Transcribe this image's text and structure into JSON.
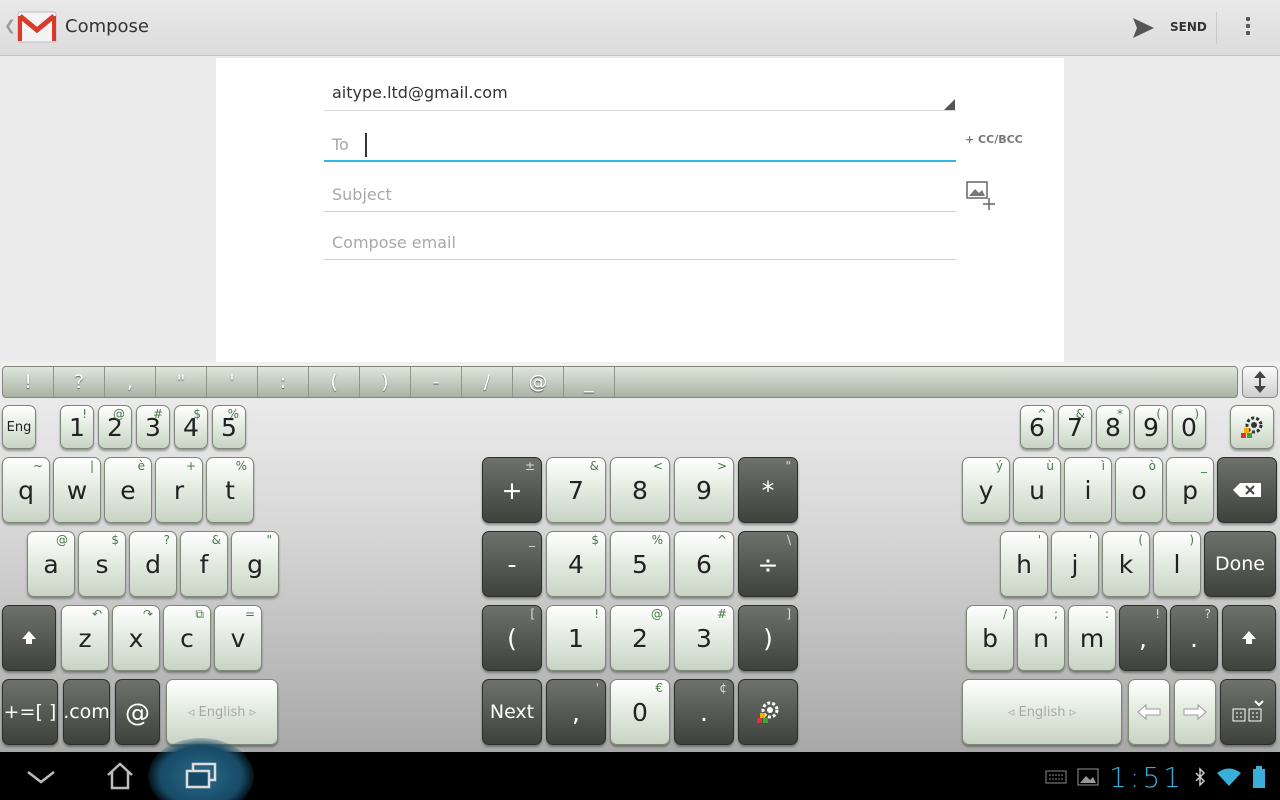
{
  "actionbar": {
    "title": "Compose",
    "send_label": "SEND"
  },
  "compose": {
    "from": "aitype.ltd@gmail.com",
    "to_placeholder": "To",
    "cc_bcc_label": "+ CC/BCC",
    "subject_placeholder": "Subject",
    "body_placeholder": "Compose email"
  },
  "keyboard": {
    "symbols": [
      "!",
      "?",
      ",",
      "\"",
      "'",
      ":",
      "(",
      ")",
      "-",
      "/",
      "@",
      "_"
    ],
    "lang_label": "Eng",
    "num_left": [
      {
        "l": "1",
        "a": "!"
      },
      {
        "l": "2",
        "a": "@"
      },
      {
        "l": "3",
        "a": "#"
      },
      {
        "l": "4",
        "a": "$"
      },
      {
        "l": "5",
        "a": "%"
      }
    ],
    "num_right": [
      {
        "l": "6",
        "a": "^"
      },
      {
        "l": "7",
        "a": "&"
      },
      {
        "l": "8",
        "a": "*"
      },
      {
        "l": "9",
        "a": "("
      },
      {
        "l": "0",
        "a": ")"
      }
    ],
    "row_q_left": [
      {
        "l": "q",
        "a": "~"
      },
      {
        "l": "w",
        "a": "|"
      },
      {
        "l": "e",
        "a": "è"
      },
      {
        "l": "r",
        "a": "+"
      },
      {
        "l": "t",
        "a": "%"
      }
    ],
    "row_a_left": [
      {
        "l": "a",
        "a": "@"
      },
      {
        "l": "s",
        "a": "$"
      },
      {
        "l": "d",
        "a": "?"
      },
      {
        "l": "f",
        "a": "&"
      },
      {
        "l": "g",
        "a": "\""
      }
    ],
    "row_z_left": [
      {
        "l": "z",
        "a": "↶"
      },
      {
        "l": "x",
        "a": "↷"
      },
      {
        "l": "c",
        "a": "⧉"
      },
      {
        "l": "v",
        "a": "="
      }
    ],
    "numpad_r1": [
      {
        "l": "+",
        "a": "±",
        "d": true
      },
      {
        "l": "7",
        "a": "&"
      },
      {
        "l": "8",
        "a": "<"
      },
      {
        "l": "9",
        "a": ">"
      },
      {
        "l": "*",
        "a": "\"",
        "d": true
      }
    ],
    "numpad_r2": [
      {
        "l": "-",
        "a": "_",
        "d": true
      },
      {
        "l": "4",
        "a": "$"
      },
      {
        "l": "5",
        "a": "%"
      },
      {
        "l": "6",
        "a": "^"
      },
      {
        "l": "÷",
        "a": "\\",
        "d": true
      }
    ],
    "numpad_r3": [
      {
        "l": "(",
        "a": "[",
        "d": true
      },
      {
        "l": "1",
        "a": "!"
      },
      {
        "l": "2",
        "a": "@"
      },
      {
        "l": "3",
        "a": "#"
      },
      {
        "l": ")",
        "a": "]",
        "d": true
      }
    ],
    "numpad_r4": [
      {
        "l": "Next",
        "a": "",
        "d": true
      },
      {
        "l": ",",
        "a": "'",
        "d": true
      },
      {
        "l": "0",
        "a": "€"
      },
      {
        "l": ".",
        "a": "¢",
        "d": true
      }
    ],
    "row_y_right": [
      {
        "l": "y",
        "a": "ý"
      },
      {
        "l": "u",
        "a": "ù"
      },
      {
        "l": "i",
        "a": "ì"
      },
      {
        "l": "o",
        "a": "ò"
      },
      {
        "l": "p",
        "a": "_"
      }
    ],
    "row_h_right": [
      {
        "l": "h",
        "a": "'"
      },
      {
        "l": "j",
        "a": "'"
      },
      {
        "l": "k",
        "a": "("
      },
      {
        "l": "l",
        "a": ")"
      }
    ],
    "row_b_right": [
      {
        "l": "b",
        "a": "/"
      },
      {
        "l": "n",
        "a": ";"
      },
      {
        "l": "m",
        "a": ":"
      }
    ],
    "comma_right": {
      "l": ",",
      "a": "!"
    },
    "period_right": {
      "l": ".",
      "a": "?"
    },
    "done_label": "Done",
    "symbols_key_label": "+=[ ]",
    "dotcom_label": ".com",
    "at_label": "@",
    "space_label": "English",
    "backspace_icon": "backspace-icon",
    "shift_icon": "shift-icon",
    "settings_icon": "gear-icon"
  },
  "navbar": {
    "clock": "1:51"
  },
  "colors": {
    "accent": "#33b5e5",
    "clock": "#3aaed8",
    "gmail_red": "#d93a2b"
  }
}
